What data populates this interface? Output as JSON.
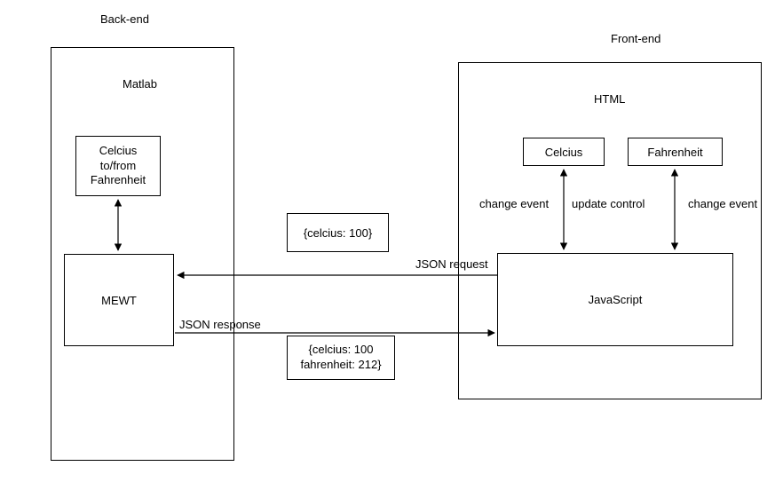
{
  "titles": {
    "backend": "Back-end",
    "frontend": "Front-end",
    "matlab": "Matlab",
    "html": "HTML"
  },
  "boxes": {
    "converter": "Celcius\nto/from\nFahrenheit",
    "mewt": "MEWT",
    "celcius": "Celcius",
    "fahrenheit": "Fahrenheit",
    "javascript": "JavaScript",
    "payload_request": "{celcius: 100}",
    "payload_response": "{celcius: 100\nfahrenheit: 212}"
  },
  "arrows": {
    "change_event_left": "change event",
    "update_control": "update control",
    "change_event_right": "change event",
    "json_request": "JSON request",
    "json_response": "JSON response"
  }
}
